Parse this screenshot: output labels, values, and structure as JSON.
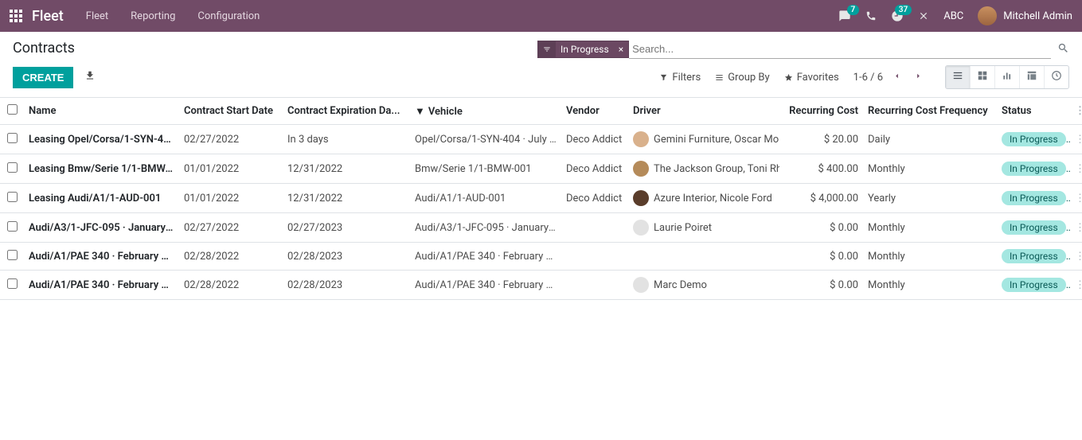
{
  "topbar": {
    "brand": "Fleet",
    "menu": [
      "Fleet",
      "Reporting",
      "Configuration"
    ],
    "messages_count": "7",
    "activities_count": "37",
    "company": "ABC",
    "user": "Mitchell Admin"
  },
  "breadcrumb": "Contracts",
  "search": {
    "active_filter": "In Progress",
    "placeholder": "Search..."
  },
  "toolbar": {
    "create": "CREATE",
    "filters": "Filters",
    "groupby": "Group By",
    "favorites": "Favorites",
    "pager": "1-6 / 6"
  },
  "columns": {
    "name": "Name",
    "start": "Contract Start Date",
    "exp": "Contract Expiration Da...",
    "vehicle": "Vehicle",
    "vendor": "Vendor",
    "driver": "Driver",
    "cost": "Recurring Cost",
    "freq": "Recurring Cost Frequency",
    "status": "Status"
  },
  "rows": [
    {
      "name": "Leasing Opel/Corsa/1-SYN-40...",
      "start": "02/27/2022",
      "exp": "In 3 days",
      "vehicle": "Opel/Corsa/1-SYN-404 · July ...",
      "vendor": "Deco Addict",
      "driver": "Gemini Furniture, Oscar Mor",
      "has_avatar": true,
      "avatar_bg": "#d9b18c",
      "cost": "$ 20.00",
      "freq": "Daily",
      "status": "In Progress"
    },
    {
      "name": "Leasing Bmw/Serie 1/1-BMW-...",
      "start": "01/01/2022",
      "exp": "12/31/2022",
      "vehicle": "Bmw/Serie 1/1-BMW-001",
      "vendor": "Deco Addict",
      "driver": "The Jackson Group, Toni Rh",
      "has_avatar": true,
      "avatar_bg": "#b58b5a",
      "cost": "$ 400.00",
      "freq": "Monthly",
      "status": "In Progress"
    },
    {
      "name": "Leasing Audi/A1/1-AUD-001",
      "start": "01/01/2022",
      "exp": "12/31/2022",
      "vehicle": "Audi/A1/1-AUD-001",
      "vendor": "Deco Addict",
      "driver": "Azure Interior, Nicole Ford",
      "has_avatar": true,
      "avatar_bg": "#5a3d2b",
      "cost": "$ 4,000.00",
      "freq": "Yearly",
      "status": "In Progress"
    },
    {
      "name": "Audi/A3/1-JFC-095 · January ...",
      "start": "02/27/2022",
      "exp": "02/27/2023",
      "vehicle": "Audi/A3/1-JFC-095 · January ...",
      "vendor": "",
      "driver": "Laurie Poiret",
      "has_avatar": true,
      "avatar_bg": "#e2e2e2",
      "cost": "$ 0.00",
      "freq": "Monthly",
      "status": "In Progress"
    },
    {
      "name": "Audi/A1/PAE 340 · February 2...",
      "start": "02/28/2022",
      "exp": "02/28/2023",
      "vehicle": "Audi/A1/PAE 340 · February 2...",
      "vendor": "",
      "driver": "",
      "has_avatar": false,
      "avatar_bg": "",
      "cost": "$ 0.00",
      "freq": "Monthly",
      "status": "In Progress"
    },
    {
      "name": "Audi/A1/PAE 340 · February 2...",
      "start": "02/28/2022",
      "exp": "02/28/2023",
      "vehicle": "Audi/A1/PAE 340 · February 2...",
      "vendor": "",
      "driver": "Marc Demo",
      "has_avatar": true,
      "avatar_bg": "#e2e2e2",
      "cost": "$ 0.00",
      "freq": "Monthly",
      "status": "In Progress"
    }
  ]
}
